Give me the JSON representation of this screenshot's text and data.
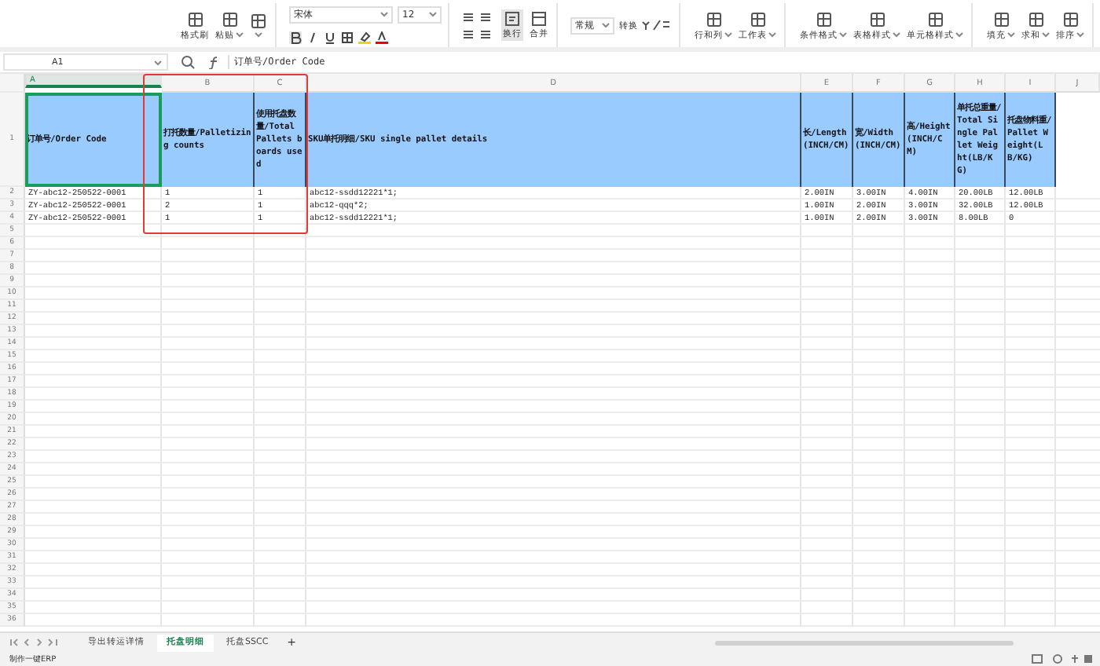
{
  "ribbon": {
    "groups": [
      {
        "items": [
          {
            "label": "格式刷",
            "caret": false
          },
          {
            "label": "粘贴",
            "caret": true
          },
          {
            "caret": true
          }
        ]
      },
      {
        "kind": "font",
        "font": "宋体",
        "size": "12"
      },
      {
        "kind": "align",
        "wrap_label": "换行",
        "merge_label": "合并"
      },
      {
        "kind": "number",
        "format": "常规",
        "convert": "转换"
      },
      {
        "items": [
          {
            "label": "行和列",
            "caret": true
          },
          {
            "label": "工作表",
            "caret": true
          }
        ]
      },
      {
        "items": [
          {
            "label": "条件格式",
            "caret": true
          },
          {
            "label": "表格样式",
            "caret": true
          },
          {
            "label": "单元格样式",
            "caret": true
          }
        ]
      },
      {
        "items": [
          {
            "label": "填充",
            "caret": true
          },
          {
            "label": "求和",
            "caret": true
          },
          {
            "label": "排序",
            "caret": true
          }
        ]
      }
    ]
  },
  "formula_bar": {
    "cell_ref": "A1",
    "formula": "订单号/Order Code"
  },
  "columns": [
    {
      "letter": "A",
      "selected": true
    },
    {
      "letter": "B",
      "selected": false
    },
    {
      "letter": "C",
      "selected": false
    },
    {
      "letter": "D",
      "selected": false
    },
    {
      "letter": "E",
      "selected": false
    },
    {
      "letter": "F",
      "selected": false
    },
    {
      "letter": "G",
      "selected": false
    },
    {
      "letter": "H",
      "selected": false
    },
    {
      "letter": "I",
      "selected": false
    },
    {
      "letter": "J",
      "selected": false
    }
  ],
  "header_row": {
    "number": "1",
    "cells": [
      "订单号/Order Code",
      "打托数量/Palletizing counts",
      "使用托盘数量/Total Pallets boards used",
      "SKU单托明细/SKU single pallet details",
      "长/Length(INCH/CM)",
      "宽/Width(INCH/CM)",
      "高/Height(INCH/CM)",
      "单托总重量/Total Single Pallet Weight(LB/KG)",
      "托盘物料重/Pallet Weight(LB/KG)"
    ]
  },
  "rows": [
    {
      "number": "2",
      "cells": [
        "ZY-abc12-250522-0001",
        "1",
        "1",
        "abc12-ssdd12221*1;",
        "2.00IN",
        "3.00IN",
        "4.00IN",
        "20.00LB",
        "12.00LB"
      ]
    },
    {
      "number": "3",
      "cells": [
        "ZY-abc12-250522-0001",
        "2",
        "1",
        "abc12-qqq*2;",
        "1.00IN",
        "2.00IN",
        "3.00IN",
        "32.00LB",
        "12.00LB"
      ]
    },
    {
      "number": "4",
      "cells": [
        "ZY-abc12-250522-0001",
        "1",
        "1",
        "abc12-ssdd12221*1;",
        "1.00IN",
        "2.00IN",
        "3.00IN",
        "8.00LB",
        "0"
      ]
    }
  ],
  "empty_row_numbers": [
    "5",
    "6",
    "7",
    "8",
    "9",
    "10",
    "11",
    "12",
    "13",
    "14",
    "15",
    "16",
    "17",
    "18",
    "19",
    "20",
    "21",
    "22",
    "23",
    "24",
    "25",
    "26",
    "27",
    "28",
    "29",
    "30",
    "31",
    "32",
    "33",
    "34",
    "35",
    "36"
  ],
  "sheet_tabs": [
    {
      "label": "导出转运详情",
      "selected": false
    },
    {
      "label": "托盘明细",
      "selected": true
    },
    {
      "label": "托盘SSCC",
      "selected": false
    }
  ],
  "add_sheet": "+",
  "status_bar": {
    "label": "制作一键ERP"
  }
}
